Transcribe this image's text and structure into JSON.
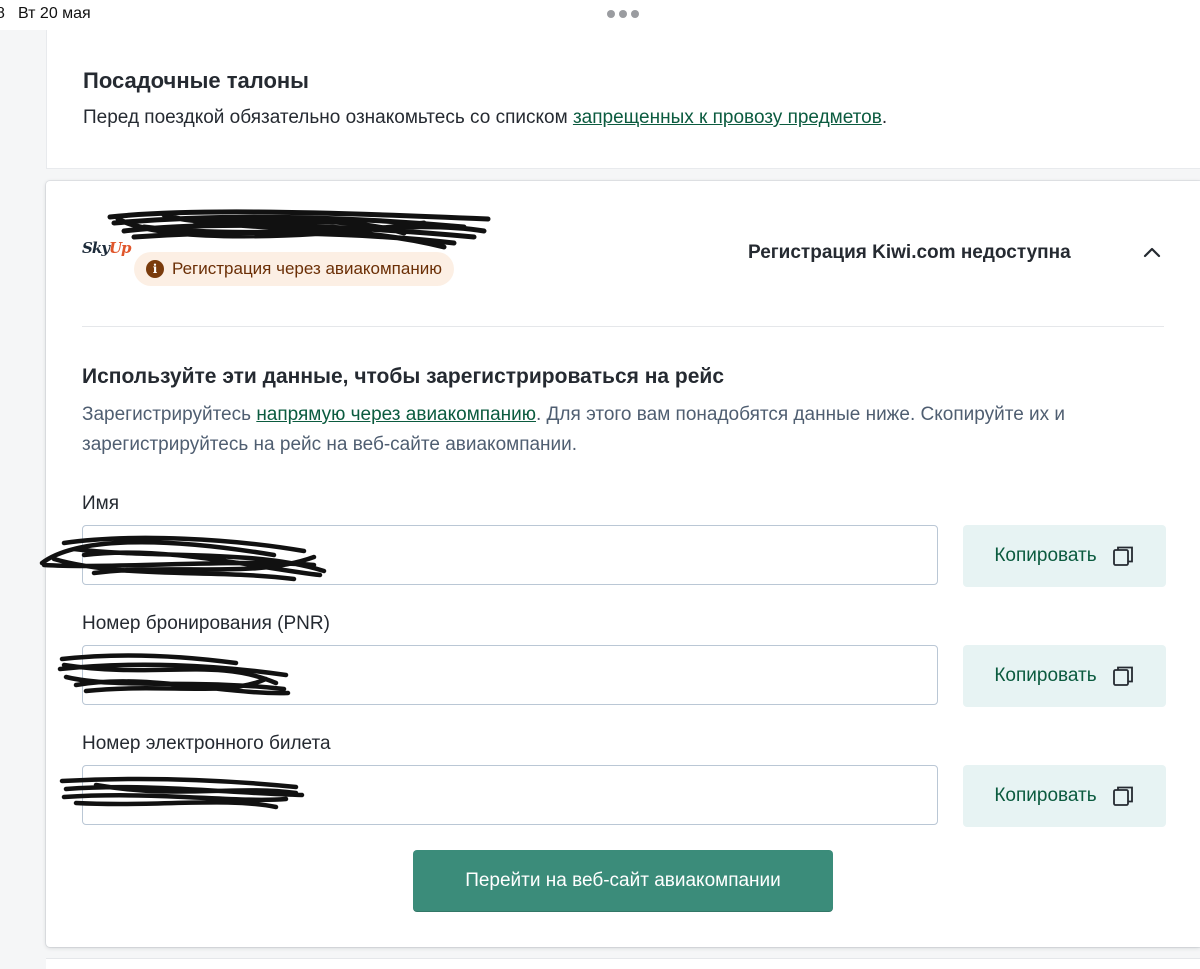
{
  "status_bar": {
    "edge_char": "8",
    "clock": "Вт 20 мая"
  },
  "boarding": {
    "title": "Посадочные талоны",
    "subtitle_before": "Перед поездкой обязательно ознакомьтесь со списком ",
    "subtitle_link": "запрещенных к провозу предметов",
    "subtitle_after": "."
  },
  "flight": {
    "airline_logo": "SkyUp",
    "airline_logo_part1": "Sky",
    "airline_logo_part2": "Up",
    "badge_icon_char": "i",
    "badge_text": "Регистрация через авиакомпанию",
    "kiwi_status": "Регистрация Kiwi.com недоступна",
    "section_title": "Используйте эти данные, чтобы зарегистрироваться на рейс",
    "desc_before": "Зарегистрируйтесь ",
    "desc_link": "напрямую через авиакомпанию",
    "desc_after": ". Для этого вам понадобятся данные ниже. Скопируйте их и зарегистрируйтесь на рейс на веб-сайте авиакомпании.",
    "fields": [
      {
        "label": "Имя",
        "copy_label": "Копировать"
      },
      {
        "label": "Номер бронирования (PNR)",
        "copy_label": "Копировать"
      },
      {
        "label": "Номер электронного билета",
        "copy_label": "Копировать"
      }
    ],
    "primary_button": "Перейти на веб-сайт авиакомпании"
  },
  "icons": {
    "badge": "info-icon",
    "collapse": "chevron-up-icon",
    "copy": "copy-icon",
    "menu": "more-dots-icon"
  },
  "colors": {
    "link": "#0b5b3f",
    "primary_button": "#3b8c7a",
    "copy_button_bg": "#e7f3f3",
    "badge_bg": "#fcefe4",
    "badge_text": "#6b2f06"
  }
}
